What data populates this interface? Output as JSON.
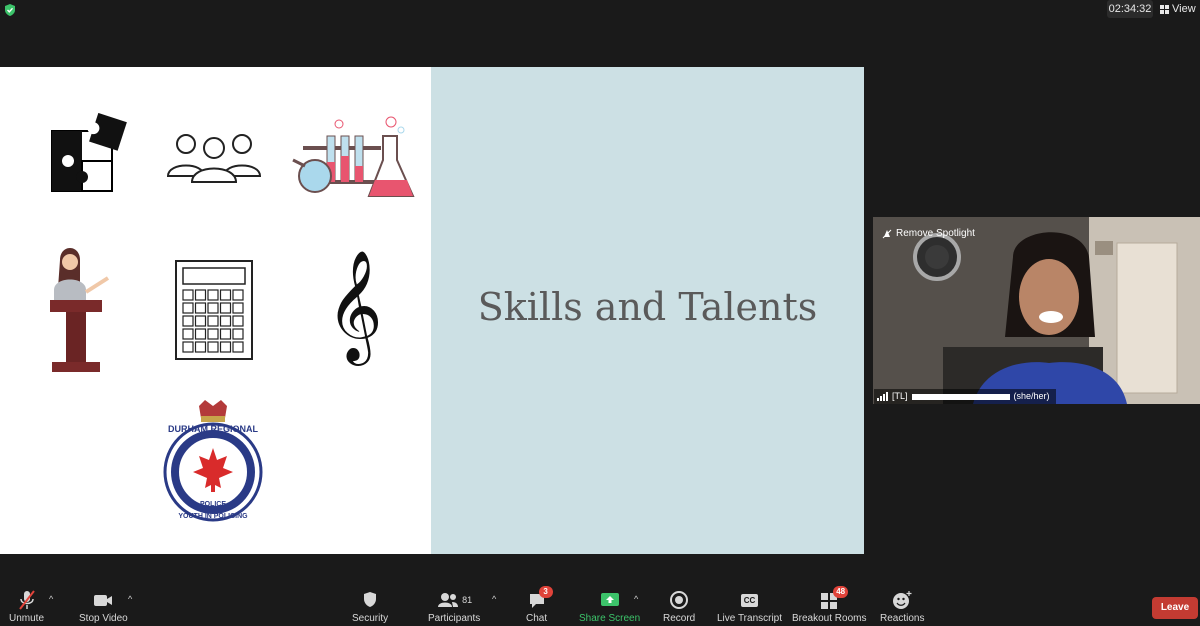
{
  "top_bar": {
    "shield_color": "#3cc36a",
    "timer": "02:34:32",
    "view_label": "View"
  },
  "slide": {
    "title": "Skills and Talents",
    "left_bg": "#ffffff",
    "right_bg": "#cce0e4",
    "icons": [
      "puzzle-icon",
      "group-icon",
      "lab-flasks-icon",
      "speaker-podium-icon",
      "calculator-icon",
      "treble-clef-icon",
      "police-logo"
    ],
    "logo_text": {
      "top": "DURHAM REGIONAL",
      "middle": "POLICE",
      "bottom": "YOUTH IN POLICING"
    }
  },
  "video": {
    "remove_spotlight": "Remove Spotlight",
    "name_prefix": "[TL]",
    "name_suffix": "(she/her)"
  },
  "toolbar": {
    "unmute": "Unmute",
    "stop_video": "Stop Video",
    "security": "Security",
    "participants": "Participants",
    "participants_count": "81",
    "chat": "Chat",
    "chat_badge": "3",
    "share_screen": "Share Screen",
    "record": "Record",
    "live_transcript": "Live Transcript",
    "cc": "CC",
    "breakout_rooms": "Breakout Rooms",
    "breakout_badge": "48",
    "reactions": "Reactions",
    "leave": "Leave",
    "share_color": "#3cc36a"
  }
}
